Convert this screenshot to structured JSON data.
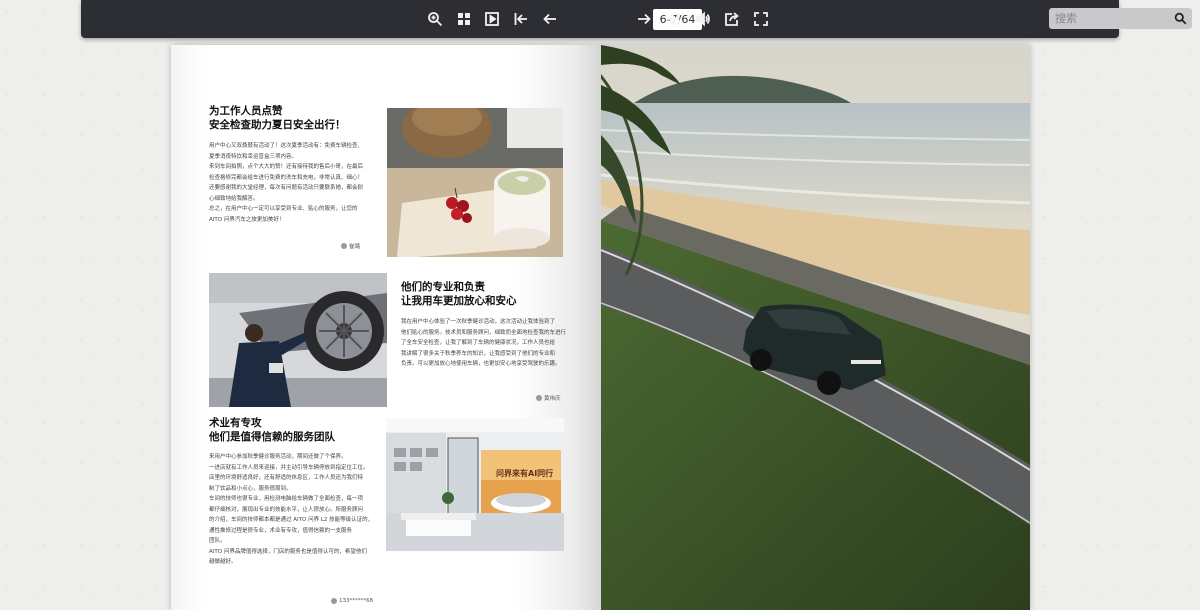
{
  "toolbar": {
    "page_indicator": "6-7/64",
    "search_placeholder": "搜索",
    "icons": [
      "zoom-icon",
      "thumbnails-icon",
      "autoplay-icon",
      "first-page-icon",
      "previous-page-icon",
      "next-page-icon",
      "last-page-icon",
      "sound-icon",
      "share-icon",
      "fullscreen-icon",
      "search-icon"
    ]
  },
  "sections": [
    {
      "title_line1": "为工作人员点赞",
      "title_line2": "安全检查助力夏日安全出行！",
      "body": [
        "用户中心又双叒叕有活动了！这次夏季活动有：免费车辆检查、",
        "夏季消夜特饮和幸运盲盒三项内容。",
        "来到车间拍照，点个大大的赞！还有接待我的售后小哥，在最后",
        "检查格修完都会给车进行免费的洗车和充电，非常认真、细心！",
        "还要感谢我的大堂经理，每次有问题有活动只要联系她，都会耐",
        "心细致地给我解答。",
        "总之，在用户中心一定可以享受到专业、贴心的服务，让您的",
        "AITO 问界汽车之旅更加美好！"
      ],
      "credit": "崔璐"
    },
    {
      "title_line1": "他们的专业和负责",
      "title_line2": "让我用车更加放心和安心",
      "body": [
        "我在用户中心体验了一次秋季健诊活动，这次活动让我体验到了",
        "他们贴心的服务。技术员和服务顾问，细致而全面地检查我的车进行",
        "了全车安全检查，让我了解到了车辆的健康状况，工作人员也给",
        "我讲解了很多关于秋季养车的知识，让我感受到了他们的专业和",
        "负责。可以更加放心地使用车辆，也更加安心地享受驾驶的乐趣。"
      ],
      "credit": "黄伟庆"
    },
    {
      "title_line1": "术业有专攻",
      "title_line2": "他们是值得信赖的服务团队",
      "body": [
        "来用户中心参加秋季健诊服务活动，期间还做了个保养。",
        "一进店就有工作人员来迎接，并主动引导车辆停放到指定位工位。",
        "店里的环境舒适良好，还有舒适的休息区，工作人员还为我们特",
        "制了饮品和小点心，服务很周到。",
        "车间的技师也很专业，用检测电脑给车辆做了全面检查，每一项",
        "都仔细核对，展现出专业的技能水平，让人很放心。所服务顾问",
        "的介绍，车间的技师都本都是通过 AITO 问界 L2 技能等级认证的，",
        "通性推修过程是很专业，术业有专攻，值得信赖的一支服务",
        "团队。",
        "AITO 问界品牌值得选择，门店的服务也是值得认可的，希望他们",
        "越做越好。"
      ],
      "credit": "133******68"
    }
  ],
  "poster": {
    "headline": "问界来有AI同行"
  }
}
